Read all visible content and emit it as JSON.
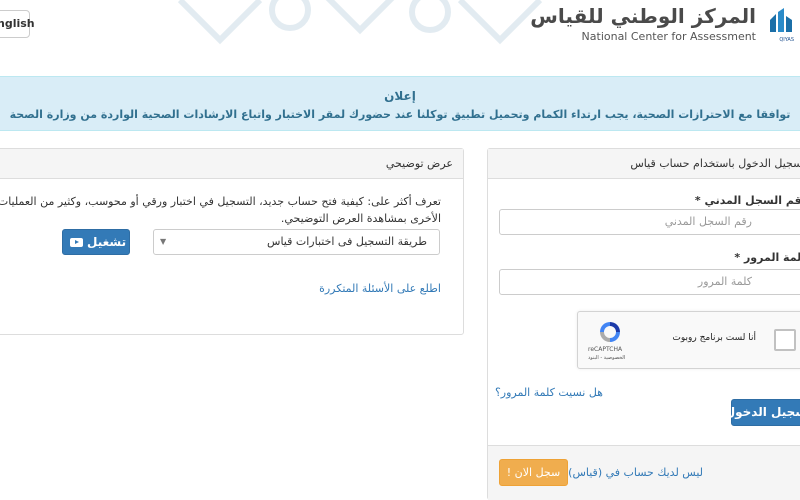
{
  "header": {
    "lang_button": "nglish",
    "logo_ar": "المركز الوطني للقياس",
    "logo_en": "National Center for Assessment",
    "logo_mark_text": "QIYAS"
  },
  "notice": {
    "title": "إعلان",
    "text": "توافقا مع الاحترازات الصحية، يجب ارتداء الكمام وتحميل تطبيق توكلنا عند حضورك لمقر الاختبار واتباع الارشادات الصحية الواردة من وزارة الصحة"
  },
  "demo_panel": {
    "title": "عرض توضيحي",
    "intro": "تعرف أكثر على: كيفية فتح حساب جديد، التسجيل في اختبار ورقي أو محوسب، وكثير من العمليات الأخرى بمشاهدة العرض التوضيحي.",
    "select_value": "طريقة التسجيل فى اختبارات قياس",
    "play_label": "تشغيل",
    "faq_link": "اطلع على الأسئلة المتكررة"
  },
  "login_panel": {
    "title": "تسجيل الدخول باستخدام حساب قياس",
    "id_label": "رقم السجل المدني *",
    "id_placeholder": "رقم السجل المدني",
    "password_label": "كلمة المرور *",
    "password_placeholder": "كلمة المرور",
    "captcha_label": "أنا لست برنامج روبوت",
    "captcha_brand": "reCAPTCHA",
    "captcha_terms": "الخصوصية - البنود",
    "forgot_link": "هل نسيت كلمة المرور؟",
    "login_button": "تسجيل الدخول",
    "no_account_text": "ليس لديك حساب في (قياس)",
    "register_button": "سجل الان !"
  },
  "colors": {
    "primary": "#337ab7",
    "warning": "#f0ad4e",
    "notice_bg": "#d9edf7",
    "notice_text": "#31708f"
  }
}
